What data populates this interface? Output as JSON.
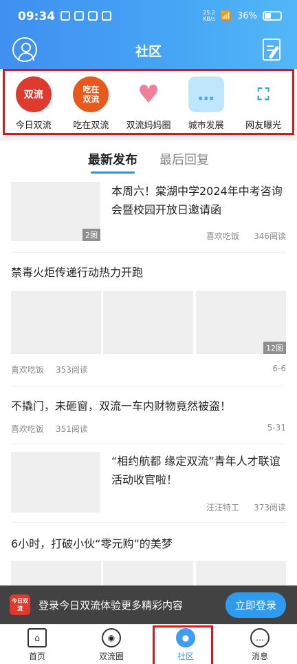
{
  "status_bar": {
    "time": "09:34",
    "net_speed_value": "25.2",
    "net_speed_unit": "KB/s",
    "battery": "36%"
  },
  "header": {
    "title": "社区"
  },
  "categories": [
    {
      "label": "今日双流",
      "icon_text": "双流"
    },
    {
      "label": "吃在双流",
      "icon_text": "吃在\n双流"
    },
    {
      "label": "双流妈妈圈",
      "icon_text": "♥"
    },
    {
      "label": "城市发展",
      "icon_text": "…"
    },
    {
      "label": "网友曝光",
      "icon_text": "⛶"
    }
  ],
  "tabs": [
    {
      "label": "最新发布"
    },
    {
      "label": "最后回复"
    }
  ],
  "posts": [
    {
      "title": "本周六！棠湖中学2024年中考咨询会暨校园开放日邀请函",
      "author": "喜欢吃饭",
      "reads": "346阅读",
      "image_count": "2图"
    },
    {
      "title": "禁毒火炬传递行动热力开跑",
      "author": "喜欢吃饭",
      "reads": "353阅读",
      "date": "6-6",
      "image_count": "12图"
    },
    {
      "title": "不撬门，未砸窗，双流一车内财物竟然被盗！",
      "author": "喜欢吃饭",
      "reads": "351阅读",
      "date": "5-31"
    },
    {
      "title": "“相约航都 缘定双流”青年人才联谊活动收官啦！",
      "author": "汪汪特工",
      "reads": "373阅读"
    },
    {
      "title": "6小时，打破小伙“零元购”的美梦"
    }
  ],
  "banner": {
    "logo_text": "今日双流",
    "text": "登录今日双流体验更多精彩内容",
    "login_label": "立即登录"
  },
  "bottom_nav": [
    {
      "label": "首页"
    },
    {
      "label": "双流圈"
    },
    {
      "label": "社区"
    },
    {
      "label": "消息"
    }
  ],
  "colors": {
    "brand": "#3f8ff0",
    "accent": "#2f8eea",
    "highlight": "#d9161c"
  }
}
